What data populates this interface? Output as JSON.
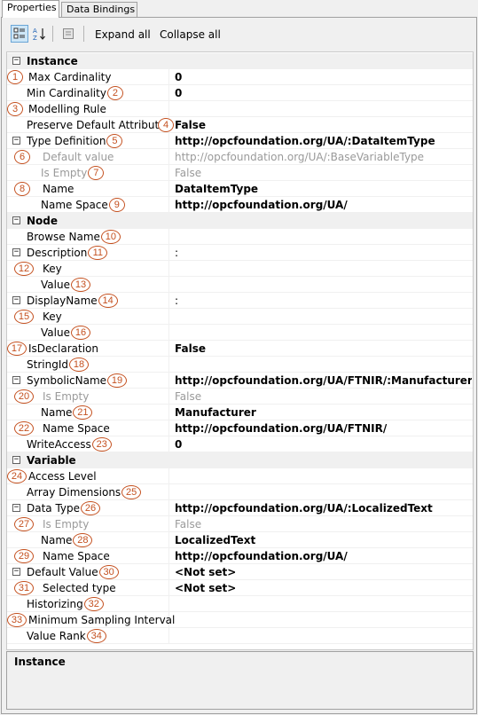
{
  "tabs": [
    {
      "label": "Properties",
      "active": true
    },
    {
      "label": "Data Bindings",
      "active": false
    }
  ],
  "toolbar": {
    "categorized_icon": "categorized-view-icon",
    "alphabetical_icon": "sort-alphabetical-icon",
    "property_pages_icon": "property-pages-icon",
    "expand_all": "Expand all",
    "collapse_all": "Collapse all"
  },
  "rows": [
    {
      "name": "Instance",
      "value": "",
      "category": true,
      "expander": "⊟",
      "level": 0
    },
    {
      "name": "Max Cardinality",
      "value": "0",
      "level": 1,
      "marker": "1",
      "marker_side": "left"
    },
    {
      "name": "Min Cardinality",
      "value": "0",
      "level": 1,
      "marker": "2",
      "marker_side": "right"
    },
    {
      "name": "Modelling Rule",
      "value": "",
      "level": 1,
      "marker": "3",
      "marker_side": "left"
    },
    {
      "name": "Preserve Default Attributes",
      "value": "False",
      "level": 1,
      "marker": "4",
      "marker_side": "right"
    },
    {
      "name": "Type Definition",
      "value": "http://opcfoundation.org/UA/:DataItemType",
      "level": 1,
      "expander": "⊟",
      "marker": "5",
      "marker_side": "right"
    },
    {
      "name": "Default value",
      "value": "http://opcfoundation.org/UA/:BaseVariableType",
      "level": 2,
      "dim": true,
      "marker": "6",
      "marker_side": "left"
    },
    {
      "name": "Is Empty",
      "value": "False",
      "level": 2,
      "dim": true,
      "marker": "7",
      "marker_side": "right"
    },
    {
      "name": "Name",
      "value": "DataItemType",
      "level": 2,
      "marker": "8",
      "marker_side": "left"
    },
    {
      "name": "Name Space",
      "value": "http://opcfoundation.org/UA/",
      "level": 2,
      "marker": "9",
      "marker_side": "right"
    },
    {
      "name": "Node",
      "value": "",
      "category": true,
      "expander": "⊟",
      "level": 0
    },
    {
      "name": "Browse Name",
      "value": "",
      "level": 1,
      "marker": "10",
      "marker_side": "right"
    },
    {
      "name": "Description",
      "value": ":",
      "level": 1,
      "expander": "⊟",
      "valueNormal": true,
      "marker": "11",
      "marker_side": "right"
    },
    {
      "name": "Key",
      "value": "",
      "level": 2,
      "marker": "12",
      "marker_side": "left"
    },
    {
      "name": "Value",
      "value": "",
      "level": 2,
      "marker": "13",
      "marker_side": "right"
    },
    {
      "name": "DisplayName",
      "value": ":",
      "level": 1,
      "expander": "⊟",
      "valueNormal": true,
      "marker": "14",
      "marker_side": "right"
    },
    {
      "name": "Key",
      "value": "",
      "level": 2,
      "marker": "15",
      "marker_side": "left"
    },
    {
      "name": "Value",
      "value": "",
      "level": 2,
      "marker": "16",
      "marker_side": "right"
    },
    {
      "name": "IsDeclaration",
      "value": "False",
      "level": 1,
      "marker": "17",
      "marker_side": "left"
    },
    {
      "name": "StringId",
      "value": "",
      "level": 1,
      "marker": "18",
      "marker_side": "right"
    },
    {
      "name": "SymbolicName",
      "value": "http://opcfoundation.org/UA/FTNIR/:Manufacturer",
      "level": 1,
      "expander": "⊟",
      "marker": "19",
      "marker_side": "right"
    },
    {
      "name": "Is Empty",
      "value": "False",
      "level": 2,
      "dim": true,
      "marker": "20",
      "marker_side": "left"
    },
    {
      "name": "Name",
      "value": "Manufacturer",
      "level": 2,
      "marker": "21",
      "marker_side": "right"
    },
    {
      "name": "Name Space",
      "value": "http://opcfoundation.org/UA/FTNIR/",
      "level": 2,
      "marker": "22",
      "marker_side": "left"
    },
    {
      "name": "WriteAccess",
      "value": "0",
      "level": 1,
      "marker": "23",
      "marker_side": "right"
    },
    {
      "name": "Variable",
      "value": "",
      "category": true,
      "expander": "⊟",
      "level": 0
    },
    {
      "name": "Access Level",
      "value": "",
      "level": 1,
      "marker": "24",
      "marker_side": "left"
    },
    {
      "name": "Array Dimensions",
      "value": "",
      "level": 1,
      "marker": "25",
      "marker_side": "right"
    },
    {
      "name": "Data Type",
      "value": "http://opcfoundation.org/UA/:LocalizedText",
      "level": 1,
      "expander": "⊟",
      "marker": "26",
      "marker_side": "right"
    },
    {
      "name": "Is Empty",
      "value": "False",
      "level": 2,
      "dim": true,
      "marker": "27",
      "marker_side": "left"
    },
    {
      "name": "Name",
      "value": "LocalizedText",
      "level": 2,
      "marker": "28",
      "marker_side": "right"
    },
    {
      "name": "Name Space",
      "value": "http://opcfoundation.org/UA/",
      "level": 2,
      "marker": "29",
      "marker_side": "left"
    },
    {
      "name": "Default Value",
      "value": "<Not set>",
      "level": 1,
      "expander": "⊟",
      "marker": "30",
      "marker_side": "right"
    },
    {
      "name": "Selected type",
      "value": "<Not set>",
      "level": 2,
      "marker": "31",
      "marker_side": "left"
    },
    {
      "name": "Historizing",
      "value": "",
      "level": 1,
      "marker": "32",
      "marker_side": "right"
    },
    {
      "name": "Minimum Sampling Interval",
      "value": "",
      "level": 1,
      "marker": "33",
      "marker_side": "left"
    },
    {
      "name": "Value Rank",
      "value": "",
      "level": 1,
      "marker": "34",
      "marker_side": "right"
    }
  ],
  "description": {
    "title": "Instance"
  },
  "colors": {
    "marker": "#c4501f",
    "dim_text": "#9a9a9a",
    "category_bg": "#f0f0f0"
  }
}
